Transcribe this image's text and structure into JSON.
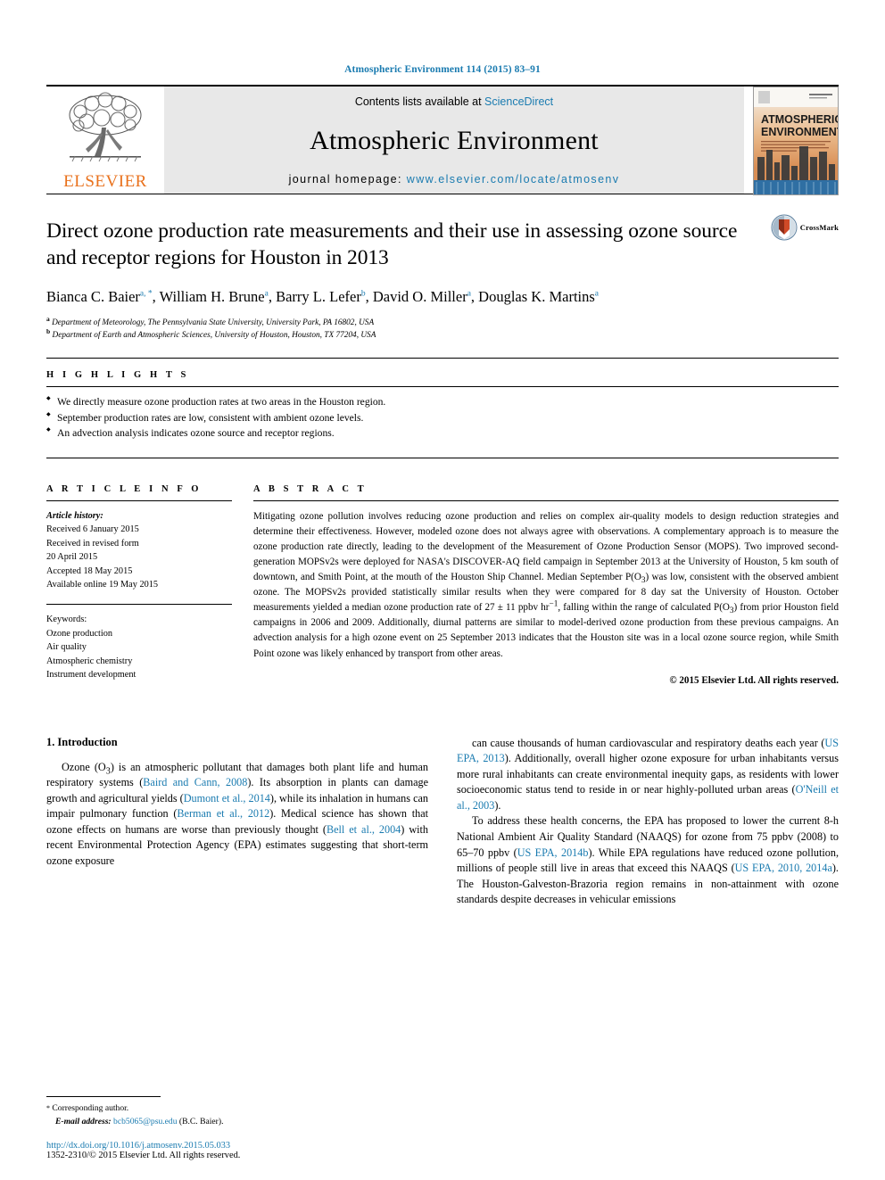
{
  "running_head": "Atmospheric Environment 114 (2015) 83–91",
  "masthead": {
    "publisher_name": "ELSEVIER",
    "contents_prefix": "Contents lists available at ",
    "contents_link": "ScienceDirect",
    "journal_title": "Atmospheric Environment",
    "homepage_label": "journal homepage: ",
    "homepage_url": "www.elsevier.com/locate/atmosenv",
    "cover_line1": "ATMOSPHERIC",
    "cover_line2": "ENVIRONMENT",
    "accent_color": "#1a7bb0",
    "elsevier_orange": "#E9711C"
  },
  "article": {
    "title": "Direct ozone production rate measurements and their use in assessing ozone source and receptor regions for Houston in 2013",
    "crossmark_label": "CrossMark",
    "authors": [
      {
        "name": "Bianca C. Baier",
        "marks": "a, *"
      },
      {
        "name": "William H. Brune",
        "marks": "a"
      },
      {
        "name": "Barry L. Lefer",
        "marks": "b"
      },
      {
        "name": "David O. Miller",
        "marks": "a"
      },
      {
        "name": "Douglas K. Martins",
        "marks": "a"
      }
    ],
    "affiliations": [
      {
        "mark": "a",
        "text": "Department of Meteorology, The Pennsylvania State University, University Park, PA 16802, USA"
      },
      {
        "mark": "b",
        "text": "Department of Earth and Atmospheric Sciences, University of Houston, Houston, TX 77204, USA"
      }
    ]
  },
  "highlights": {
    "heading": "H I G H L I G H T S",
    "items": [
      "We directly measure ozone production rates at two areas in the Houston region.",
      "September production rates are low, consistent with ambient ozone levels.",
      "An advection analysis indicates ozone source and receptor regions."
    ]
  },
  "article_info": {
    "heading": "A R T I C L E   I N F O",
    "history_label": "Article history:",
    "history": [
      "Received 6 January 2015",
      "Received in revised form",
      "20 April 2015",
      "Accepted 18 May 2015",
      "Available online 19 May 2015"
    ],
    "keywords_label": "Keywords:",
    "keywords": [
      "Ozone production",
      "Air quality",
      "Atmospheric chemistry",
      "Instrument development"
    ]
  },
  "abstract": {
    "heading": "A B S T R A C T",
    "text": "Mitigating ozone pollution involves reducing ozone production and relies on complex air-quality models to design reduction strategies and determine their effectiveness. However, modeled ozone does not always agree with observations. A complementary approach is to measure the ozone production rate directly, leading to the development of the Measurement of Ozone Production Sensor (MOPS). Two improved second-generation MOPSv2s were deployed for NASA's DISCOVER-AQ field campaign in September 2013 at the University of Houston, 5 km south of downtown, and Smith Point, at the mouth of the Houston Ship Channel. Median September P(O3) was low, consistent with the observed ambient ozone. The MOPSv2s provided statistically similar results when they were compared for 8 day sat the University of Houston. October measurements yielded a median ozone production rate of 27 ± 11 ppbv hr−1, falling within the range of calculated P(O3) from prior Houston field campaigns in 2006 and 2009. Additionally, diurnal patterns are similar to model-derived ozone production from these previous campaigns. An advection analysis for a high ozone event on 25 September 2013 indicates that the Houston site was in a local ozone source region, while Smith Point ozone was likely enhanced by transport from other areas.",
    "copyright": "© 2015 Elsevier Ltd. All rights reserved."
  },
  "body": {
    "section_heading": "1. Introduction",
    "left_paragraph": "Ozone (O3) is an atmospheric pollutant that damages both plant life and human respiratory systems (Baird and Cann, 2008). Its absorption in plants can damage growth and agricultural yields (Dumont et al., 2014), while its inhalation in humans can impair pulmonary function (Berman et al., 2012). Medical science has shown that ozone effects on humans are worse than previously thought (Bell et al., 2004) with recent Environmental Protection Agency (EPA) estimates suggesting that short-term ozone exposure",
    "right_paragraph_1": "can cause thousands of human cardiovascular and respiratory deaths each year (US EPA, 2013). Additionally, overall higher ozone exposure for urban inhabitants versus more rural inhabitants can create environmental inequity gaps, as residents with lower socioeconomic status tend to reside in or near highly-polluted urban areas (O'Neill et al., 2003).",
    "right_paragraph_2": "To address these health concerns, the EPA has proposed to lower the current 8-h National Ambient Air Quality Standard (NAAQS) for ozone from 75 ppbv (2008) to 65–70 ppbv (US EPA, 2014b). While EPA regulations have reduced ozone pollution, millions of people still live in areas that exceed this NAAQS (US EPA, 2010, 2014a). The Houston-Galveston-Brazoria region remains in non-attainment with ozone standards despite decreases in vehicular emissions"
  },
  "footer": {
    "corresponding_author": "Corresponding author.",
    "email_label": "E-mail address:",
    "email": "bcb5065@psu.edu",
    "email_owner": "(B.C. Baier).",
    "doi": "http://dx.doi.org/10.1016/j.atmosenv.2015.05.033",
    "issn_line": "1352-2310/© 2015 Elsevier Ltd. All rights reserved."
  }
}
